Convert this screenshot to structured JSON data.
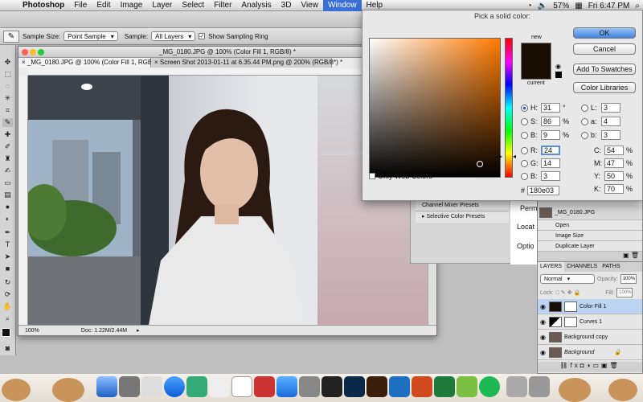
{
  "menubar": {
    "app": "Photoshop",
    "items": [
      "File",
      "Edit",
      "Image",
      "Layer",
      "Select",
      "Filter",
      "Analysis",
      "3D",
      "View",
      "Window",
      "Help"
    ],
    "active": "Window",
    "battery": "57%",
    "clock": "Fri 6:47 PM"
  },
  "options": {
    "sample_size_label": "Sample Size:",
    "sample_size_value": "Point Sample",
    "sample_label": "Sample:",
    "sample_value": "All Layers",
    "ring_label": "Show Sampling Ring"
  },
  "document": {
    "title": "_MG_0180.JPG @ 100% (Color Fill 1, RGB/8) *",
    "tabs": [
      "_MG_0180.JPG @ 100% (Color Fill 1, RGB/8) *",
      "Screen Shot 2013-01-11 at 6.35.44 PM.png @ 200% (RGB/8*) *"
    ],
    "zoom": "100%",
    "doc_info": "Doc: 1.22M/2.44M"
  },
  "picker": {
    "title": "Pick a solid color:",
    "new_label": "new",
    "current_label": "current",
    "ok": "OK",
    "cancel": "Cancel",
    "add_swatches": "Add To Swatches",
    "color_libraries": "Color Libraries",
    "web_only": "Only Web Colors",
    "h": "31",
    "s": "86",
    "b": "9",
    "r": "24",
    "g": "14",
    "bl": "3",
    "l": "3",
    "a": "4",
    "lb": "3",
    "c": "54",
    "m": "47",
    "y": "50",
    "k": "70",
    "hex": "180e03",
    "new_color": "#180e03",
    "current_color": "#180e03"
  },
  "mid_panel": {
    "items": [
      "Channel Mixer Presets",
      "Selective Color Presets"
    ],
    "side_labels": [
      "Perm",
      "Locat",
      "Optio"
    ]
  },
  "history": {
    "items": [
      "_MG_0180.JPG",
      "Open",
      "Image Size",
      "Duplicate Layer"
    ]
  },
  "layers": {
    "tabs": [
      "LAYERS",
      "CHANNELS",
      "PATHS"
    ],
    "blend": "Normal",
    "opacity_label": "Opacity:",
    "opacity": "100%",
    "lock_label": "Lock:",
    "fill_label": "Fill:",
    "fill": "100%",
    "items": [
      "Color Fill 1",
      "Curves 1",
      "Background copy",
      "Background"
    ]
  }
}
